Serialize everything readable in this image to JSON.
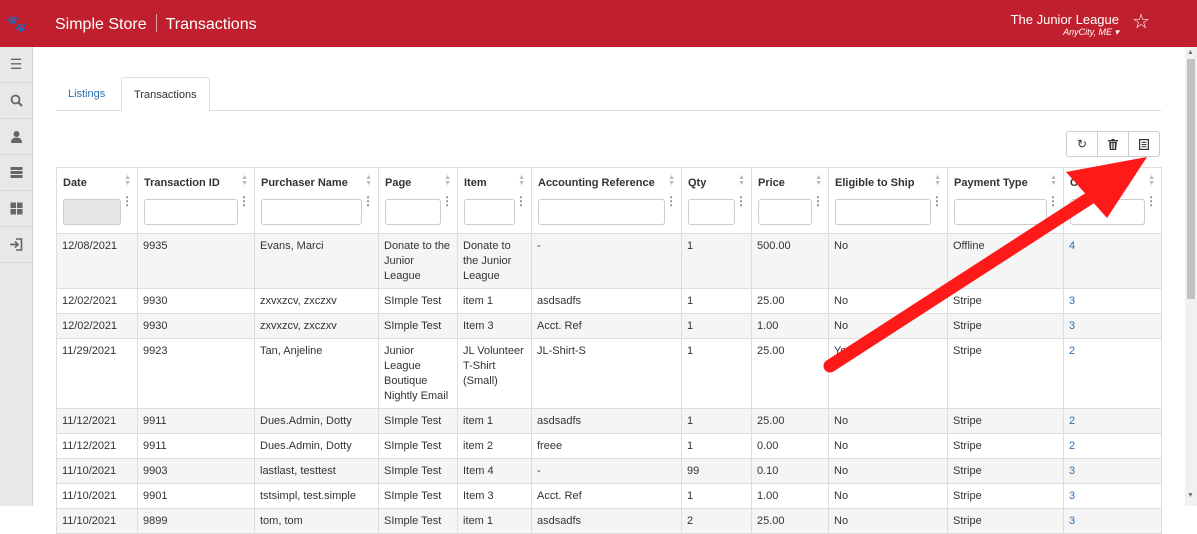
{
  "header": {
    "app_name": "Simple Store",
    "page_title": "Transactions",
    "org_name": "The Junior League",
    "org_location": "AnyCity, ME"
  },
  "tabs": [
    {
      "label": "Listings"
    },
    {
      "label": "Transactions"
    }
  ],
  "table": {
    "columns": [
      {
        "label": "Date"
      },
      {
        "label": "Transaction ID"
      },
      {
        "label": "Purchaser Name"
      },
      {
        "label": "Page"
      },
      {
        "label": "Item"
      },
      {
        "label": "Accounting Reference"
      },
      {
        "label": "Qty"
      },
      {
        "label": "Price"
      },
      {
        "label": "Eligible to Ship"
      },
      {
        "label": "Payment Type"
      },
      {
        "label": "Comments"
      }
    ],
    "rows": [
      [
        "12/08/2021",
        "9935",
        "Evans, Marci",
        "Donate to the Junior League",
        "Donate to the Junior League",
        "-",
        "1",
        "500.00",
        "No",
        "Offline",
        "4"
      ],
      [
        "12/02/2021",
        "9930",
        "zxvxzcv, zxczxv",
        "SImple Test",
        "item 1",
        "asdsadfs",
        "1",
        "25.00",
        "No",
        "Stripe",
        "3"
      ],
      [
        "12/02/2021",
        "9930",
        "zxvxzcv, zxczxv",
        "SImple Test",
        "Item 3",
        "Acct. Ref",
        "1",
        "1.00",
        "No",
        "Stripe",
        "3"
      ],
      [
        "11/29/2021",
        "9923",
        "Tan, Anjeline",
        "Junior League Boutique Nightly Email",
        "JL Volunteer T-Shirt (Small)",
        "JL-Shirt-S",
        "1",
        "25.00",
        "Yes",
        "Stripe",
        "2"
      ],
      [
        "11/12/2021",
        "9911",
        "Dues.Admin, Dotty",
        "SImple Test",
        "item 1",
        "asdsadfs",
        "1",
        "25.00",
        "No",
        "Stripe",
        "2"
      ],
      [
        "11/12/2021",
        "9911",
        "Dues.Admin, Dotty",
        "SImple Test",
        "item 2",
        "freee",
        "1",
        "0.00",
        "No",
        "Stripe",
        "2"
      ],
      [
        "11/10/2021",
        "9903",
        "lastlast, testtest",
        "SImple Test",
        "Item 4",
        "-",
        "99",
        "0.10",
        "No",
        "Stripe",
        "3"
      ],
      [
        "11/10/2021",
        "9901",
        "tstsimpl, test.simple",
        "SImple Test",
        "Item 3",
        "Acct. Ref",
        "1",
        "1.00",
        "No",
        "Stripe",
        "3"
      ],
      [
        "11/10/2021",
        "9899",
        "tom, tom",
        "SImple Test",
        "item 1",
        "asdsadfs",
        "2",
        "25.00",
        "No",
        "Stripe",
        "3"
      ]
    ]
  },
  "icons": {
    "logo": "paw-icon",
    "favorite": "star-icon",
    "refresh": "refresh-icon",
    "delete": "trash-icon",
    "export": "export-icon"
  },
  "colors": {
    "brand": "#c0202e",
    "link": "#2c6fad",
    "annotation_arrow": "#ff0000"
  }
}
